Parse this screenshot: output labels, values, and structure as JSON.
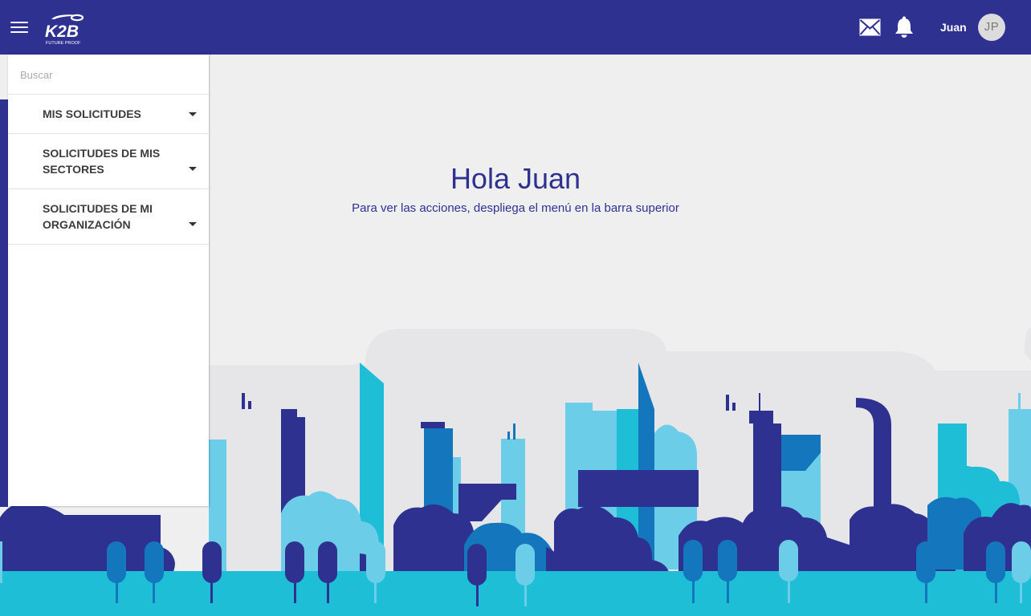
{
  "header": {
    "logo_text": "K2B",
    "logo_tagline": "FUTURE PROOF",
    "user_name": "Juan",
    "avatar_initials": "JP"
  },
  "sidebar": {
    "search_placeholder": "Buscar",
    "items": [
      {
        "label": "MIS SOLICITUDES"
      },
      {
        "label": "SOLICITUDES DE MIS SECTORES"
      },
      {
        "label": "SOLICITUDES DE MI ORGANIZACIÓN"
      }
    ]
  },
  "main": {
    "greeting": "Hola Juan",
    "subtitle": "Para ver las acciones, despliega el menú en la barra superior"
  },
  "colors": {
    "brand": "#2f3191",
    "accent_cyan": "#1ebfd6",
    "light_blue": "#6ccde9",
    "mid_blue": "#1477be",
    "background": "#efeff0"
  }
}
